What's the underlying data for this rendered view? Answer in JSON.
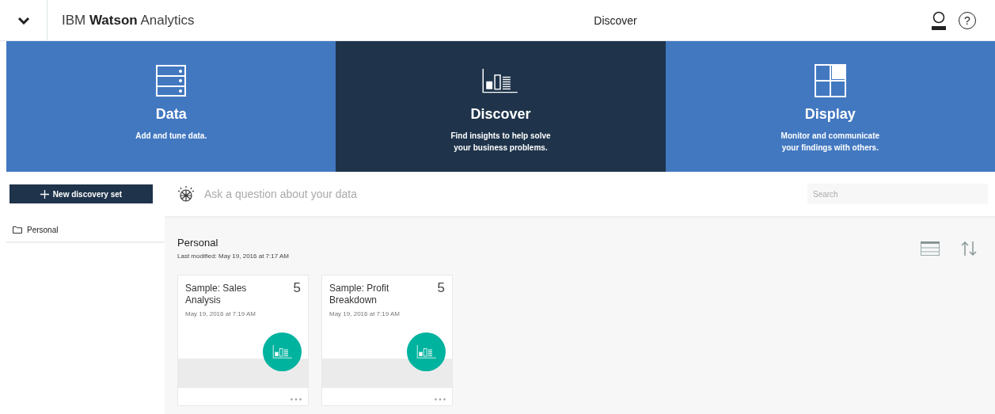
{
  "header": {
    "brand": "IBM **Watson** Analytics",
    "title": "Discover",
    "help": "?"
  },
  "tiles": [
    {
      "kind": "data",
      "title": "Data",
      "lines": [
        "Add and tune data."
      ],
      "selected": false
    },
    {
      "kind": "discover",
      "title": "Discover",
      "lines": [
        "Find insights to help solve",
        "your business problems."
      ],
      "selected": true
    },
    {
      "kind": "display",
      "title": "Display",
      "lines": [
        "Monitor and communicate",
        "your findings with others."
      ],
      "selected": false
    }
  ],
  "new_button": "New discovery set",
  "ask": {
    "placeholder": "Ask a question about your data"
  },
  "search": {
    "placeholder": "Search"
  },
  "sidebar": {
    "items": [
      {
        "label": "Personal"
      }
    ]
  },
  "folder": {
    "title": "Personal",
    "modified": "Last modified: May 19, 2016 at 7:17 AM"
  },
  "cards": [
    {
      "title": "Sample: Sales Analysis",
      "count": "5",
      "date": "May 19, 2016 at 7:19 AM"
    },
    {
      "title": "Sample: Profit Breakdown",
      "count": "5",
      "date": "May 19, 2016 at 7:19 AM"
    }
  ]
}
